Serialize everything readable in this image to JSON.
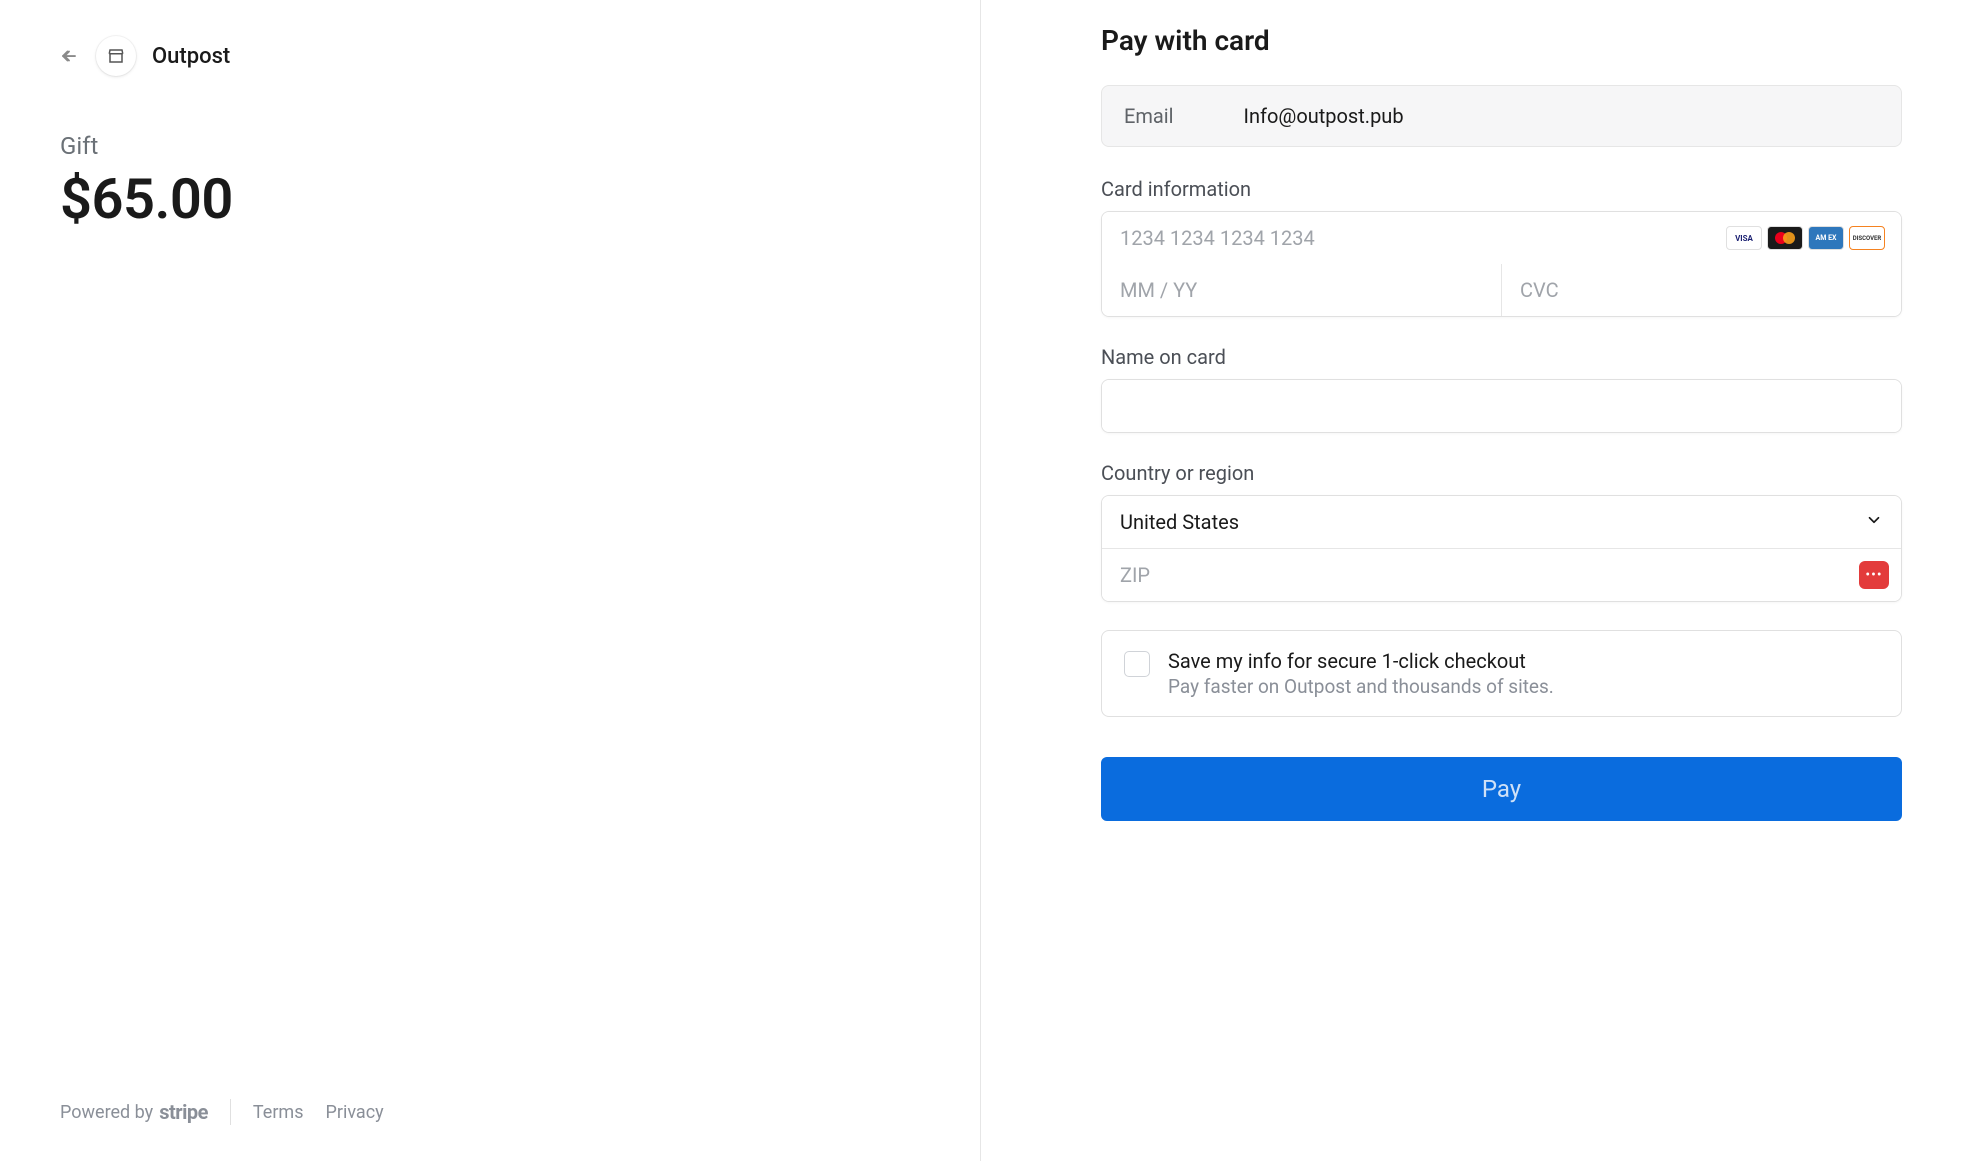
{
  "merchant": {
    "name": "Outpost"
  },
  "product": {
    "name": "Gift",
    "price": "$65.00"
  },
  "footer": {
    "powered_by": "Powered by",
    "stripe": "stripe",
    "terms": "Terms",
    "privacy": "Privacy"
  },
  "checkout": {
    "title": "Pay with card",
    "email_label": "Email",
    "email_value": "Info@outpost.pub",
    "card_label": "Card information",
    "card_number_placeholder": "1234 1234 1234 1234",
    "expiry_placeholder": "MM / YY",
    "cvc_placeholder": "CVC",
    "name_label": "Name on card",
    "country_label": "Country or region",
    "country_value": "United States",
    "zip_placeholder": "ZIP",
    "save_main": "Save my info for secure 1-click checkout",
    "save_sub": "Pay faster on Outpost and thousands of sites.",
    "pay_button": "Pay",
    "brands": {
      "visa": "VISA",
      "amex": "AM EX",
      "disc": "DISCOVER"
    }
  }
}
